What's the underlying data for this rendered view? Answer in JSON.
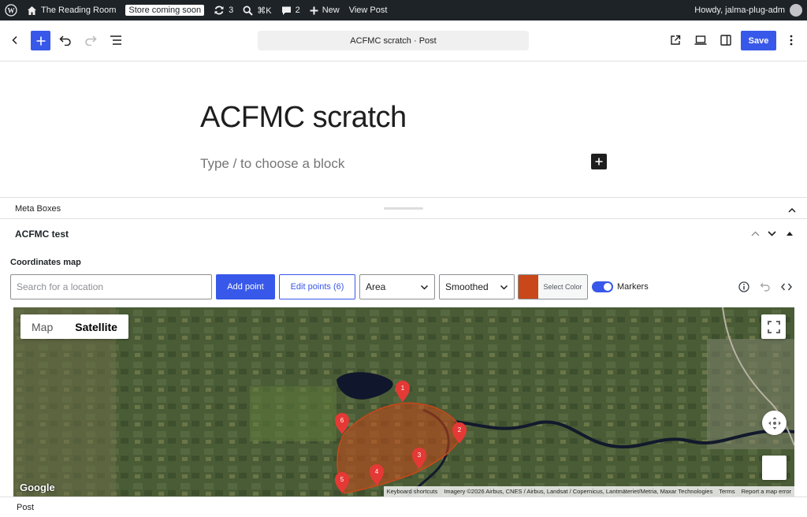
{
  "admin_bar": {
    "site_name": "The Reading Room",
    "store_badge": "Store coming soon",
    "updates_count": "3",
    "shortcut": "⌘K",
    "comments_count": "2",
    "new_label": "New",
    "view_post": "View Post",
    "greeting": "Howdy, jalma-plug-adm"
  },
  "header": {
    "document_title": "ACFMC scratch · Post",
    "save_label": "Save"
  },
  "canvas": {
    "post_title": "ACFMC scratch",
    "block_placeholder": "Type / to choose a block"
  },
  "meta": {
    "section_label": "Meta Boxes",
    "panel_title": "ACFMC test",
    "field_label": "Coordinates map"
  },
  "map_toolbar": {
    "search_placeholder": "Search for a location",
    "add_point": "Add point",
    "edit_points": "Edit points (6)",
    "shape_select": "Area",
    "line_select": "Smoothed",
    "color_label": "Select Color",
    "polygon_color": "#c9481a",
    "markers_label": "Markers",
    "markers_on": true
  },
  "map": {
    "type_map": "Map",
    "type_satellite": "Satellite",
    "selected_type": "Satellite",
    "google_logo": "Google",
    "markers": [
      "1",
      "2",
      "3",
      "4",
      "5",
      "6"
    ],
    "attribution": {
      "shortcuts": "Keyboard shortcuts",
      "imagery": "Imagery ©2026 Airbus, CNES / Airbus, Landsat / Copernicus, Lantmäteriet/Metria, Maxar Technologies",
      "terms": "Terms",
      "report": "Report a map error"
    }
  },
  "footer": {
    "breadcrumb": "Post"
  },
  "colors": {
    "accent": "#3858e9",
    "admin_bar": "#1d2327",
    "marker": "#e53935"
  }
}
